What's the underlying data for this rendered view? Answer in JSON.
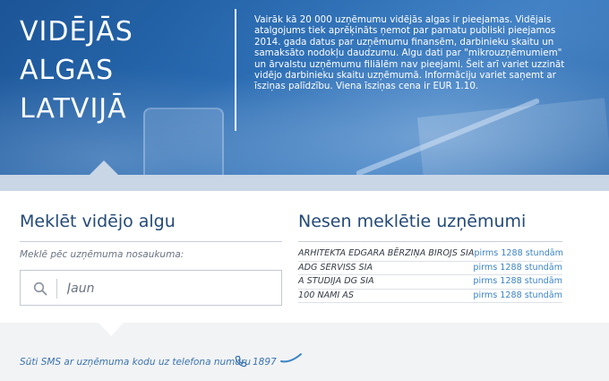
{
  "hero": {
    "title_lines": [
      "VIDĒJĀS",
      "ALGAS",
      "LATVIJĀ"
    ],
    "description": "Vairāk kā 20 000 uzņēmumu vidējās algas ir pieejamas. Vidējais atalgojums tiek aprēķināts ņemot par pamatu publiski pieejamos 2014. gada datus par uzņēmumu finansēm, darbinieku skaitu un samaksāto nodokļu daudzumu. Algu dati par \"mikrouzņēmumiem\" un ārvalstu uzņēmumu filiālēm nav pieejami. Šeit arī variet uzzināt vidējo darbinieku skaitu uzņēmumā. Informāciju variet saņemt ar īsziņas palīdzību. Viena īsziņas cena ir EUR 1.10."
  },
  "search": {
    "title": "Meklēt vidējo algu",
    "hint": "Meklē pēc uzņēmuma nosaukuma:",
    "value": "Jaun",
    "icon": "search-icon"
  },
  "recent": {
    "title": "Nesen meklētie uzņēmumi",
    "items": [
      {
        "name": "ARHITEKTA EDGARA BĒRZIŅA BIROJS SIA",
        "time": "pirms 1288 stundām"
      },
      {
        "name": "ADG SERVISS SIA",
        "time": "pirms 1288 stundām"
      },
      {
        "name": "A STUDIJA DG SIA",
        "time": "pirms 1288 stundām"
      },
      {
        "name": "100 NAMI AS",
        "time": "pirms 1288 stundām"
      }
    ]
  },
  "footer": {
    "sms_text": "Sūti SMS ar uzņēmuma kodu uz telefona numuru",
    "number": "1897",
    "icons": [
      "phone-icon",
      "swoosh-icon"
    ]
  },
  "colors": {
    "hero_blue": "#2a6db4",
    "heading_blue": "#244a78",
    "link_blue": "#3b84c4",
    "band": "#c9d6e6"
  }
}
